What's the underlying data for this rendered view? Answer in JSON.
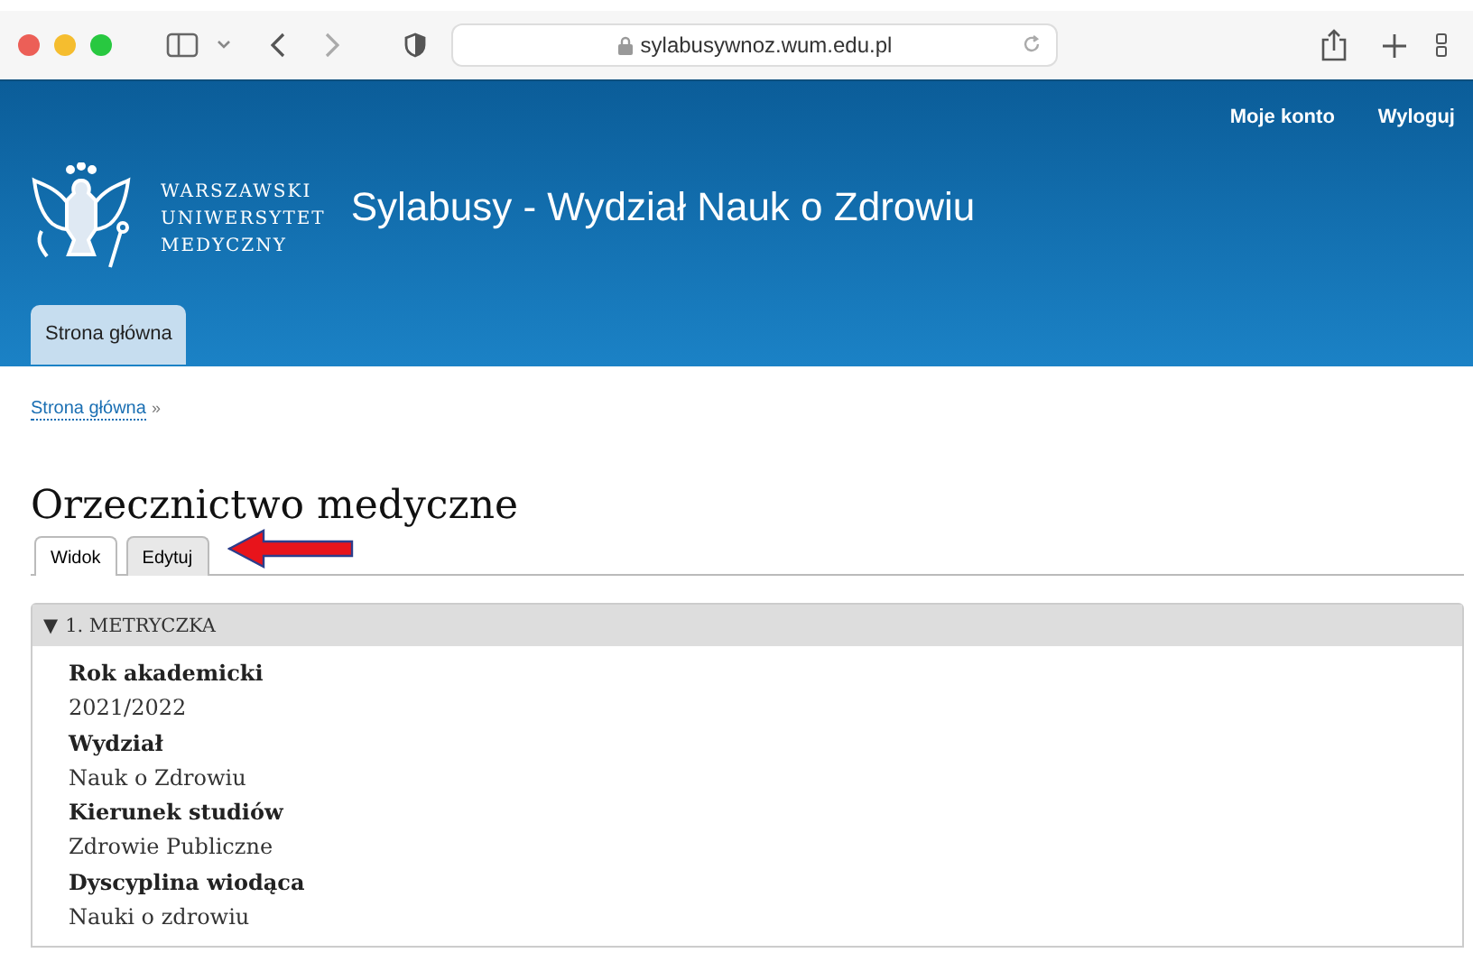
{
  "browser": {
    "url": "sylabusywnoz.wum.edu.pl"
  },
  "header": {
    "user_links": [
      "Moje konto",
      "Wyloguj"
    ],
    "logo_lines": [
      "WARSZAWSKI",
      "UNIWERSYTET",
      "MEDYCZNY"
    ],
    "site_title": "Sylabusy - Wydział Nauk o Zdrowiu",
    "nav_tabs": [
      {
        "label": "Strona główna",
        "selected": true
      }
    ]
  },
  "breadcrumb": {
    "link": "Strona główna",
    "separator": "»"
  },
  "page_title": "Orzecznictwo medyczne",
  "tabs": [
    {
      "label": "Widok",
      "selected": true
    },
    {
      "label": "Edytuj",
      "selected": false
    }
  ],
  "section": {
    "toggle": "▼",
    "title": "1. METRYCZKA",
    "expanded": true,
    "fields": [
      {
        "label": "Rok akademicki",
        "value": "2021/2022"
      },
      {
        "label": "Wydział",
        "value": "Nauk o Zdrowiu"
      },
      {
        "label": "Kierunek studiów",
        "value": "Zdrowie Publiczne"
      },
      {
        "label": "Dyscyplina wiodąca",
        "value": "Nauki o zdrowiu"
      }
    ]
  }
}
